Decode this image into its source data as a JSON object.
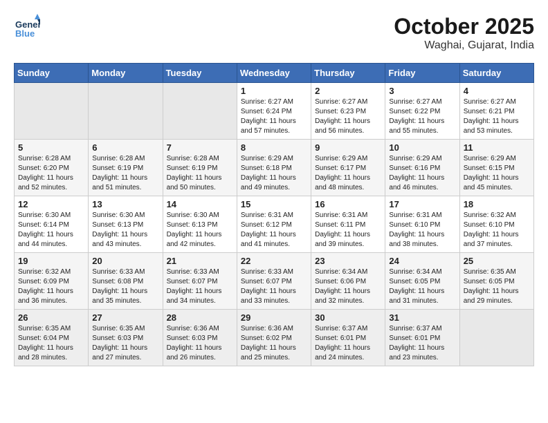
{
  "header": {
    "logo_line1": "General",
    "logo_line2": "Blue",
    "month_year": "October 2025",
    "location": "Waghai, Gujarat, India"
  },
  "days_of_week": [
    "Sunday",
    "Monday",
    "Tuesday",
    "Wednesday",
    "Thursday",
    "Friday",
    "Saturday"
  ],
  "weeks": [
    [
      {
        "day": "",
        "info": "",
        "empty": true
      },
      {
        "day": "",
        "info": "",
        "empty": true
      },
      {
        "day": "",
        "info": "",
        "empty": true
      },
      {
        "day": "1",
        "info": "Sunrise: 6:27 AM\nSunset: 6:24 PM\nDaylight: 11 hours\nand 57 minutes.",
        "empty": false
      },
      {
        "day": "2",
        "info": "Sunrise: 6:27 AM\nSunset: 6:23 PM\nDaylight: 11 hours\nand 56 minutes.",
        "empty": false
      },
      {
        "day": "3",
        "info": "Sunrise: 6:27 AM\nSunset: 6:22 PM\nDaylight: 11 hours\nand 55 minutes.",
        "empty": false
      },
      {
        "day": "4",
        "info": "Sunrise: 6:27 AM\nSunset: 6:21 PM\nDaylight: 11 hours\nand 53 minutes.",
        "empty": false
      }
    ],
    [
      {
        "day": "5",
        "info": "Sunrise: 6:28 AM\nSunset: 6:20 PM\nDaylight: 11 hours\nand 52 minutes.",
        "empty": false
      },
      {
        "day": "6",
        "info": "Sunrise: 6:28 AM\nSunset: 6:19 PM\nDaylight: 11 hours\nand 51 minutes.",
        "empty": false
      },
      {
        "day": "7",
        "info": "Sunrise: 6:28 AM\nSunset: 6:19 PM\nDaylight: 11 hours\nand 50 minutes.",
        "empty": false
      },
      {
        "day": "8",
        "info": "Sunrise: 6:29 AM\nSunset: 6:18 PM\nDaylight: 11 hours\nand 49 minutes.",
        "empty": false
      },
      {
        "day": "9",
        "info": "Sunrise: 6:29 AM\nSunset: 6:17 PM\nDaylight: 11 hours\nand 48 minutes.",
        "empty": false
      },
      {
        "day": "10",
        "info": "Sunrise: 6:29 AM\nSunset: 6:16 PM\nDaylight: 11 hours\nand 46 minutes.",
        "empty": false
      },
      {
        "day": "11",
        "info": "Sunrise: 6:29 AM\nSunset: 6:15 PM\nDaylight: 11 hours\nand 45 minutes.",
        "empty": false
      }
    ],
    [
      {
        "day": "12",
        "info": "Sunrise: 6:30 AM\nSunset: 6:14 PM\nDaylight: 11 hours\nand 44 minutes.",
        "empty": false
      },
      {
        "day": "13",
        "info": "Sunrise: 6:30 AM\nSunset: 6:13 PM\nDaylight: 11 hours\nand 43 minutes.",
        "empty": false
      },
      {
        "day": "14",
        "info": "Sunrise: 6:30 AM\nSunset: 6:13 PM\nDaylight: 11 hours\nand 42 minutes.",
        "empty": false
      },
      {
        "day": "15",
        "info": "Sunrise: 6:31 AM\nSunset: 6:12 PM\nDaylight: 11 hours\nand 41 minutes.",
        "empty": false
      },
      {
        "day": "16",
        "info": "Sunrise: 6:31 AM\nSunset: 6:11 PM\nDaylight: 11 hours\nand 39 minutes.",
        "empty": false
      },
      {
        "day": "17",
        "info": "Sunrise: 6:31 AM\nSunset: 6:10 PM\nDaylight: 11 hours\nand 38 minutes.",
        "empty": false
      },
      {
        "day": "18",
        "info": "Sunrise: 6:32 AM\nSunset: 6:10 PM\nDaylight: 11 hours\nand 37 minutes.",
        "empty": false
      }
    ],
    [
      {
        "day": "19",
        "info": "Sunrise: 6:32 AM\nSunset: 6:09 PM\nDaylight: 11 hours\nand 36 minutes.",
        "empty": false
      },
      {
        "day": "20",
        "info": "Sunrise: 6:33 AM\nSunset: 6:08 PM\nDaylight: 11 hours\nand 35 minutes.",
        "empty": false
      },
      {
        "day": "21",
        "info": "Sunrise: 6:33 AM\nSunset: 6:07 PM\nDaylight: 11 hours\nand 34 minutes.",
        "empty": false
      },
      {
        "day": "22",
        "info": "Sunrise: 6:33 AM\nSunset: 6:07 PM\nDaylight: 11 hours\nand 33 minutes.",
        "empty": false
      },
      {
        "day": "23",
        "info": "Sunrise: 6:34 AM\nSunset: 6:06 PM\nDaylight: 11 hours\nand 32 minutes.",
        "empty": false
      },
      {
        "day": "24",
        "info": "Sunrise: 6:34 AM\nSunset: 6:05 PM\nDaylight: 11 hours\nand 31 minutes.",
        "empty": false
      },
      {
        "day": "25",
        "info": "Sunrise: 6:35 AM\nSunset: 6:05 PM\nDaylight: 11 hours\nand 29 minutes.",
        "empty": false
      }
    ],
    [
      {
        "day": "26",
        "info": "Sunrise: 6:35 AM\nSunset: 6:04 PM\nDaylight: 11 hours\nand 28 minutes.",
        "empty": false
      },
      {
        "day": "27",
        "info": "Sunrise: 6:35 AM\nSunset: 6:03 PM\nDaylight: 11 hours\nand 27 minutes.",
        "empty": false
      },
      {
        "day": "28",
        "info": "Sunrise: 6:36 AM\nSunset: 6:03 PM\nDaylight: 11 hours\nand 26 minutes.",
        "empty": false
      },
      {
        "day": "29",
        "info": "Sunrise: 6:36 AM\nSunset: 6:02 PM\nDaylight: 11 hours\nand 25 minutes.",
        "empty": false
      },
      {
        "day": "30",
        "info": "Sunrise: 6:37 AM\nSunset: 6:01 PM\nDaylight: 11 hours\nand 24 minutes.",
        "empty": false
      },
      {
        "day": "31",
        "info": "Sunrise: 6:37 AM\nSunset: 6:01 PM\nDaylight: 11 hours\nand 23 minutes.",
        "empty": false
      },
      {
        "day": "",
        "info": "",
        "empty": true
      }
    ]
  ]
}
